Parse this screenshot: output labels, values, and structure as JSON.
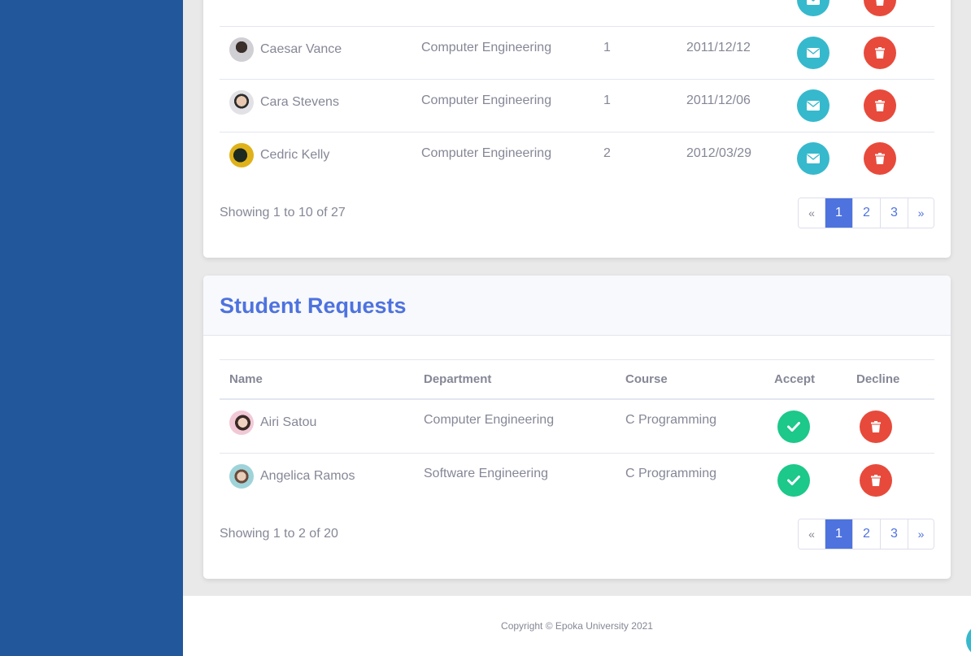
{
  "teachers": {
    "rows": [
      {
        "name": "Caesar Vance",
        "department": "Computer Engineering",
        "level": "1",
        "date": "2011/12/12"
      },
      {
        "name": "Cara Stevens",
        "department": "Computer Engineering",
        "level": "1",
        "date": "2011/12/06"
      },
      {
        "name": "Cedric Kelly",
        "department": "Computer Engineering",
        "level": "2",
        "date": "2012/03/29"
      }
    ],
    "showing": "Showing 1 to 10 of 27",
    "pager": {
      "prev": "«",
      "pages": [
        "1",
        "2",
        "3"
      ],
      "next": "»"
    }
  },
  "requests": {
    "title": "Student Requests",
    "columns": {
      "name": "Name",
      "department": "Department",
      "course": "Course",
      "accept": "Accept",
      "decline": "Decline"
    },
    "rows": [
      {
        "name": "Airi Satou",
        "department": "Computer Engineering",
        "course": "C Programming"
      },
      {
        "name": "Angelica Ramos",
        "department": "Software Engineering",
        "course": "C Programming"
      }
    ],
    "showing": "Showing 1 to 2 of 20",
    "pager": {
      "prev": "«",
      "pages": [
        "1",
        "2",
        "3"
      ],
      "next": "»"
    }
  },
  "footer": {
    "copyright": "Copyright © Epoka University 2021"
  },
  "colors": {
    "sidebar": "#22579b",
    "primary": "#4e73df",
    "info": "#36b9cc",
    "danger": "#e74a3b",
    "success": "#1cc88a"
  },
  "icons": {
    "mail": "envelope-icon",
    "delete": "trash-icon",
    "accept": "check-icon"
  }
}
